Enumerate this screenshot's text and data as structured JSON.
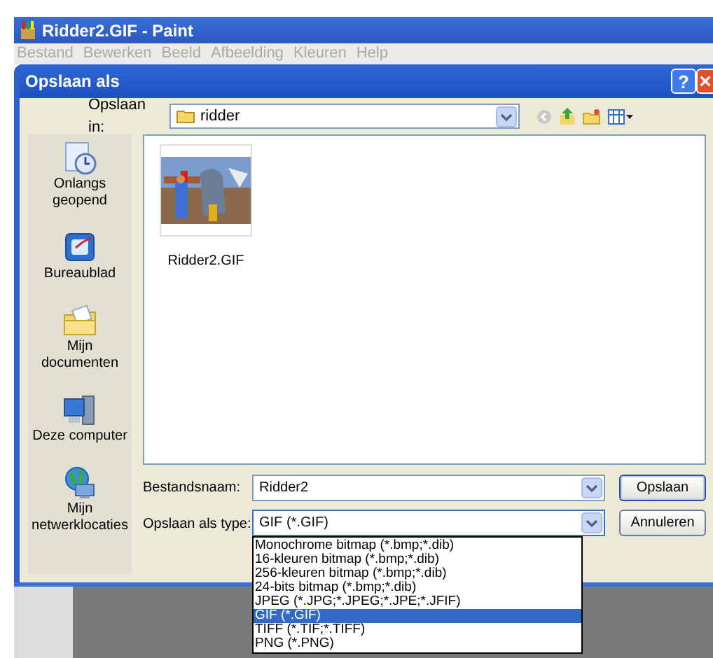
{
  "app_window": {
    "title": "Ridder2.GIF - Paint"
  },
  "menu": [
    "Bestand",
    "Bewerken",
    "Beeld",
    "Afbeelding",
    "Kleuren",
    "Help"
  ],
  "dialog": {
    "title": "Opslaan als",
    "help": "?",
    "close": "×"
  },
  "location": {
    "label": "Opslaan in:",
    "value": "ridder"
  },
  "places": [
    {
      "kind": "recent",
      "label": "Onlangs geopend"
    },
    {
      "kind": "desktop",
      "label": "Bureaublad"
    },
    {
      "kind": "documents",
      "label": "Mijn documenten"
    },
    {
      "kind": "computer",
      "label": "Deze computer"
    },
    {
      "kind": "network",
      "label": "Mijn netwerklocaties"
    }
  ],
  "files": [
    {
      "kind": "picture",
      "name": "Ridder2.GIF"
    }
  ],
  "filename": {
    "label": "Bestandsnaam:",
    "value": "Ridder2"
  },
  "filetype": {
    "label": "Opslaan als type:",
    "value": "GIF (*.GIF)",
    "expanded": true
  },
  "type_options": [
    {
      "label": "Monochrome bitmap (*.bmp;*.dib)",
      "selected": false
    },
    {
      "label": "16-kleuren bitmap (*.bmp;*.dib)",
      "selected": false
    },
    {
      "label": "256-kleuren bitmap (*.bmp;*.dib)",
      "selected": false
    },
    {
      "label": "24-bits bitmap (*.bmp;*.dib)",
      "selected": false
    },
    {
      "label": "JPEG (*.JPG;*.JPEG;*.JPE;*.JFIF)",
      "selected": false
    },
    {
      "label": "GIF (*.GIF)",
      "selected": true
    },
    {
      "label": "TIFF (*.TIF;*.TIFF)",
      "selected": false
    },
    {
      "label": "PNG (*.PNG)",
      "selected": false
    }
  ],
  "buttons": [
    "Opslaan",
    "Annuleren"
  ]
}
